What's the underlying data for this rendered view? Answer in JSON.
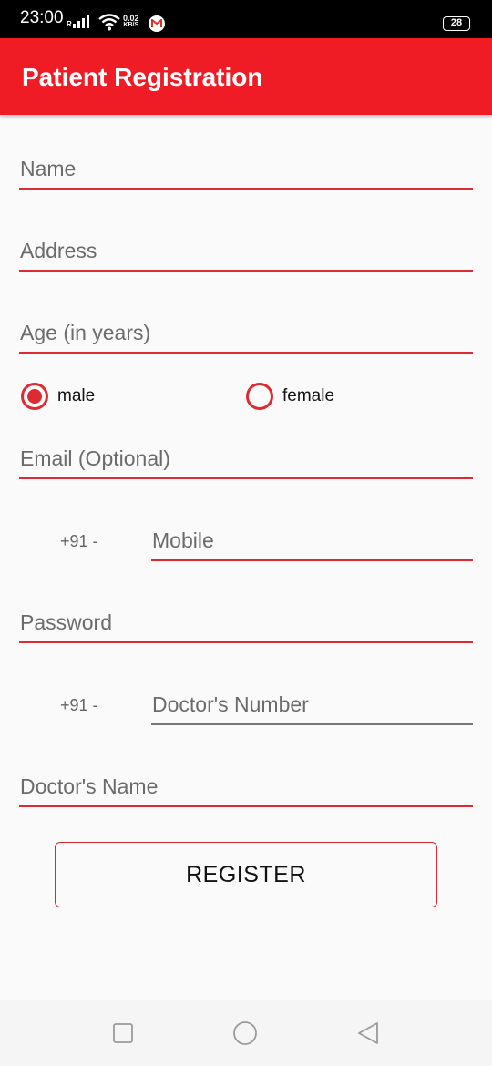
{
  "status_bar": {
    "time": "23:00",
    "network_flag": "R",
    "speed_value": "0.02",
    "speed_unit": "KB/S",
    "battery": "28",
    "icons": [
      "signal-icon",
      "wifi-icon",
      "gmail-icon",
      "battery-icon"
    ]
  },
  "app_bar": {
    "title": "Patient Registration",
    "color": "#ef1c26"
  },
  "form": {
    "name_placeholder": "Name",
    "address_placeholder": "Address",
    "age_placeholder": "Age (in years)",
    "gender": {
      "options": [
        {
          "label": "male",
          "selected": true
        },
        {
          "label": "female",
          "selected": false
        }
      ]
    },
    "email_placeholder": "Email (Optional)",
    "mobile_prefix": "+91 -",
    "mobile_placeholder": "Mobile",
    "password_placeholder": "Password",
    "doctor_number_prefix": "+91 -",
    "doctor_number_placeholder": "Doctor's Number",
    "doctor_name_placeholder": "Doctor's Name",
    "register_label": "REGISTER"
  },
  "nav_bar": {
    "buttons": [
      "recents-square-icon",
      "home-circle-icon",
      "back-triangle-icon"
    ]
  }
}
